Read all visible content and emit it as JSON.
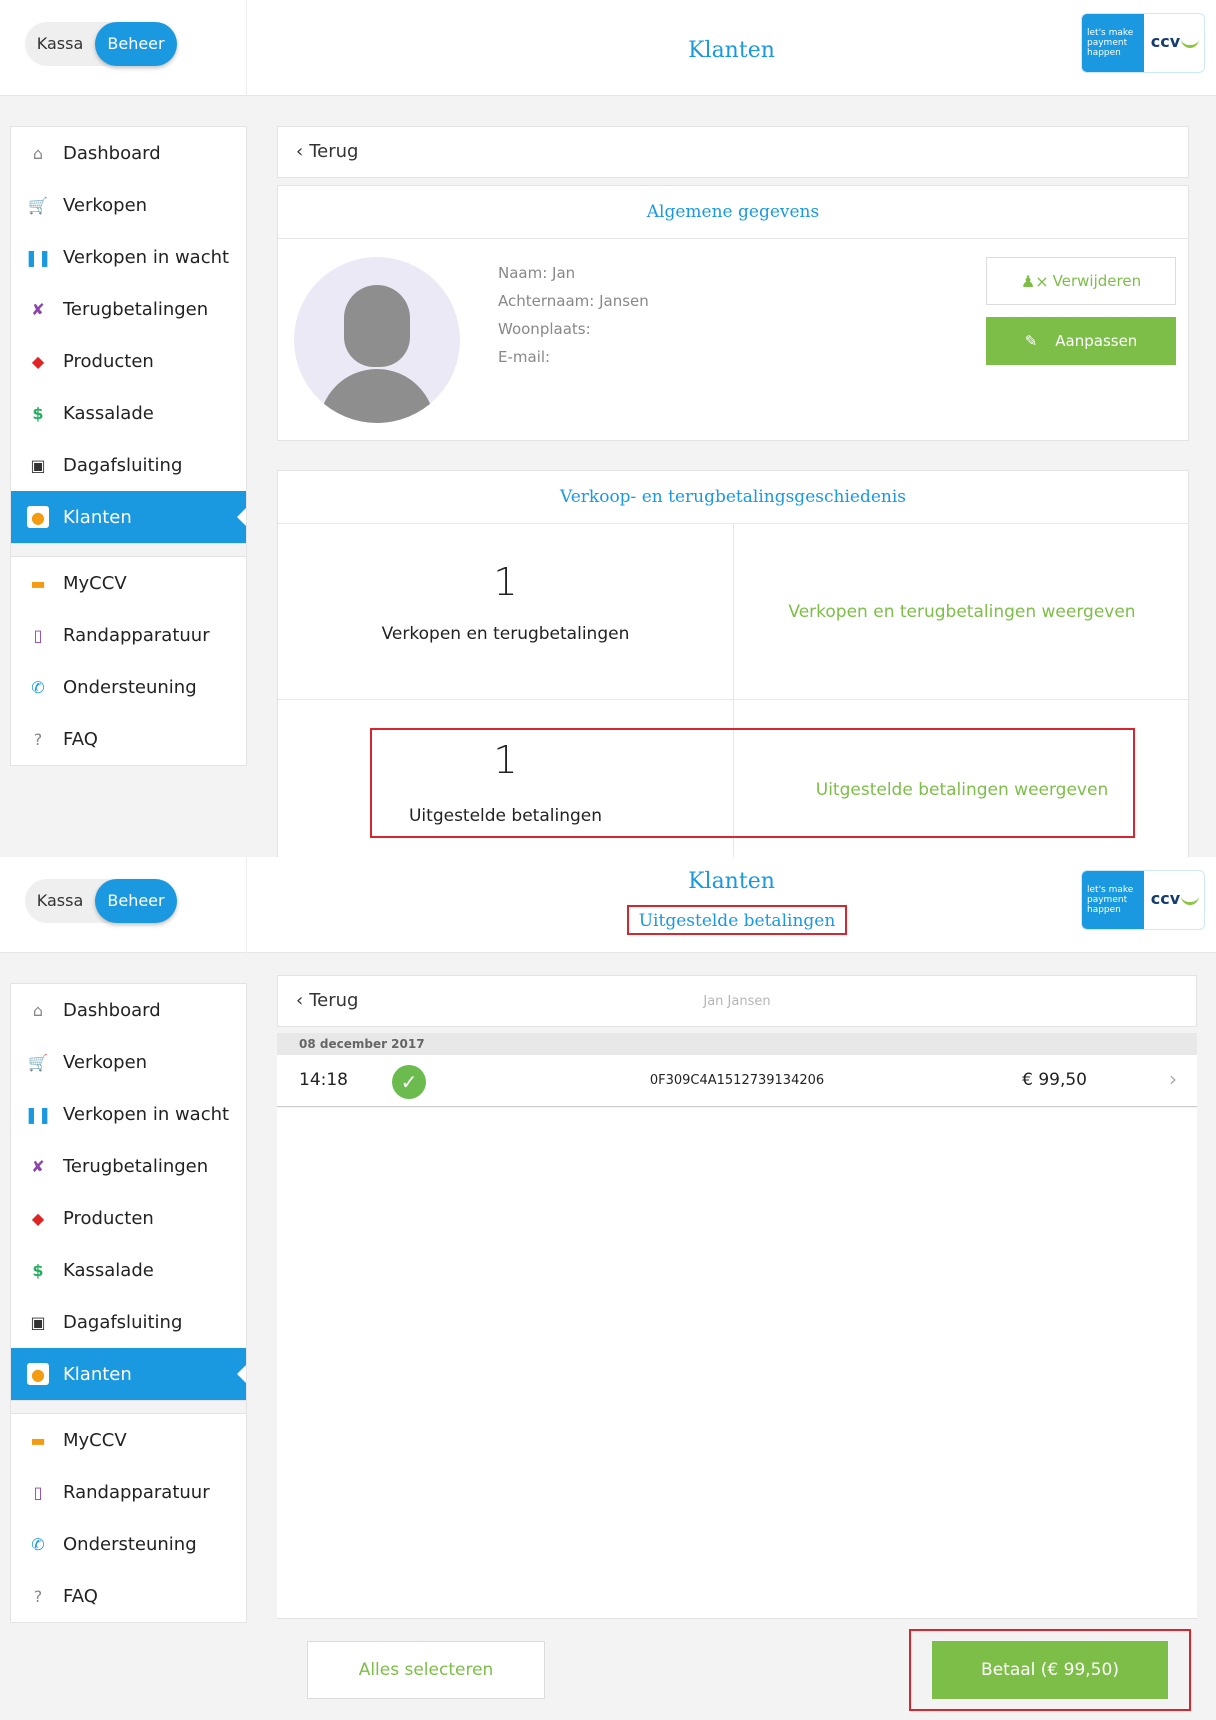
{
  "toggle": {
    "kassa": "Kassa",
    "beheer": "Beheer"
  },
  "header": {
    "title": "Klanten",
    "subtitle": "Uitgestelde betalingen"
  },
  "logo": {
    "tagline_1": "let's make",
    "tagline_2": "payment",
    "tagline_3": "happen",
    "brand": "ccv"
  },
  "sidebar": {
    "items": [
      {
        "label": "Dashboard",
        "icon": "home-icon",
        "color": "#888888"
      },
      {
        "label": "Verkopen",
        "icon": "cart-icon",
        "color": "#f39c12"
      },
      {
        "label": "Verkopen in wacht",
        "icon": "pause-icon",
        "color": "#1a98e0"
      },
      {
        "label": "Terugbetalingen",
        "icon": "cart-return-icon",
        "color": "#8e44ad"
      },
      {
        "label": "Producten",
        "icon": "layers-icon",
        "color": "#e02424"
      },
      {
        "label": "Kassalade",
        "icon": "dollar-icon",
        "color": "#27ae60"
      },
      {
        "label": "Dagafsluiting",
        "icon": "calendar-icon",
        "color": "#333333"
      },
      {
        "label": "Klanten",
        "icon": "users-icon",
        "color": "#f39c12"
      }
    ],
    "extra_items": [
      {
        "label": "MyCCV",
        "icon": "laptop-icon",
        "color": "#f39c12"
      },
      {
        "label": "Randapparatuur",
        "icon": "tablet-icon",
        "color": "#8e44ad"
      },
      {
        "label": "Ondersteuning",
        "icon": "phone-icon",
        "color": "#1a98e0"
      },
      {
        "label": "FAQ",
        "icon": "question-icon",
        "color": "#888888"
      }
    ]
  },
  "back": {
    "label": "Terug",
    "customer_name": "Jan Jansen"
  },
  "general": {
    "title": "Algemene gegevens",
    "naam": "Naam: Jan",
    "achternaam": "Achternaam: Jansen",
    "woonplaats": "Woonplaats:",
    "email": "E-mail:",
    "delete_label": "Verwijderen",
    "edit_label": "Aanpassen"
  },
  "history": {
    "title": "Verkoop- en terugbetalingsgeschiedenis",
    "sales_count": "1",
    "sales_label": "Verkopen en terugbetalingen",
    "sales_link": "Verkopen en terugbetalingen weergeven",
    "deferred_count": "1",
    "deferred_label": "Uitgestelde betalingen",
    "deferred_link": "Uitgestelde betalingen weergeven"
  },
  "deferred_list": {
    "date": "08 december 2017",
    "rows": [
      {
        "time": "14:18",
        "ref": "0F309C4A1512739134206",
        "amount": "€ 99,50"
      }
    ],
    "select_all_label": "Alles selecteren",
    "pay_label": "Betaal (€ 99,50)"
  },
  "colors": {
    "accent": "#1a98e0",
    "green": "#7dbe48",
    "highlight": "#d9252e"
  }
}
